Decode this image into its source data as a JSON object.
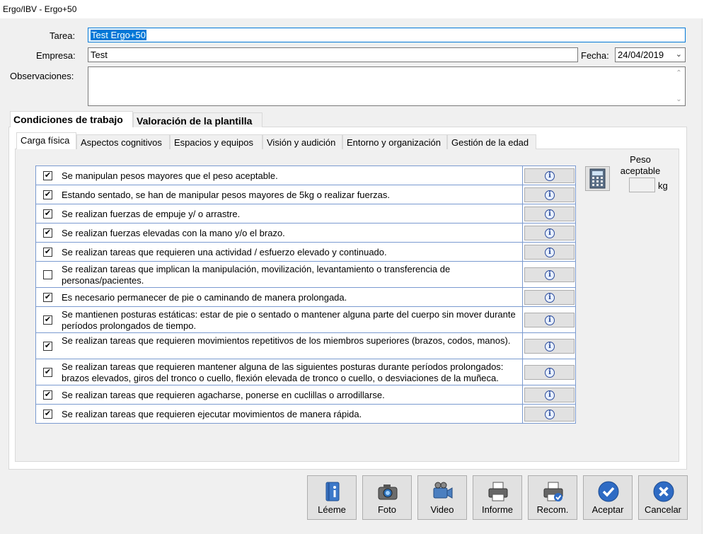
{
  "window": {
    "title": "Ergo/IBV - Ergo+50"
  },
  "form": {
    "tarea_label": "Tarea:",
    "tarea_value": "Test Ergo+50",
    "empresa_label": "Empresa:",
    "empresa_value": "Test",
    "fecha_label": "Fecha:",
    "fecha_value": "24/04/2019",
    "observaciones_label": "Observaciones:",
    "observaciones_value": ""
  },
  "main_tabs": [
    {
      "label": "Condiciones de trabajo",
      "active": true
    },
    {
      "label": "Valoración de la plantilla",
      "active": false
    }
  ],
  "sub_tabs": [
    {
      "label": "Carga física",
      "active": true
    },
    {
      "label": "Aspectos cognitivos",
      "active": false
    },
    {
      "label": "Espacios y equipos",
      "active": false
    },
    {
      "label": "Visión y audición",
      "active": false
    },
    {
      "label": "Entorno y organización",
      "active": false
    },
    {
      "label": "Gestión de la edad",
      "active": false
    }
  ],
  "items": [
    {
      "text": "Se manipulan pesos mayores que el peso aceptable.",
      "checked": true
    },
    {
      "text": "Estando sentado, se han  de manipular pesos mayores de 5kg o realizar fuerzas.",
      "checked": true
    },
    {
      "text": "Se realizan fuerzas de empuje y/ o arrastre.",
      "checked": true
    },
    {
      "text": "Se realizan fuerzas elevadas con la mano y/o el brazo.",
      "checked": true
    },
    {
      "text": "Se realizan tareas que requieren una actividad / esfuerzo elevado y continuado.",
      "checked": true
    },
    {
      "text": "Se realizan tareas que implican la manipulación, movilización, levantamiento o transferencia de personas/pacientes.",
      "checked": false
    },
    {
      "text": "Es necesario permanecer de pie o caminando de manera prolongada.",
      "checked": true
    },
    {
      "text": "Se mantienen posturas estáticas: estar de pie o sentado o mantener alguna parte del cuerpo sin mover durante períodos prolongados de tiempo.",
      "checked": true
    },
    {
      "text": "Se realizan tareas que requieren movimientos repetitivos de los miembros superiores (brazos, codos, manos).",
      "checked": true
    },
    {
      "text": "Se realizan tareas que requieren mantener alguna de las siguientes posturas durante períodos prolongados: brazos elevados, giros del tronco o cuello, flexión elevada de tronco o cuello, o desviaciones de la muñeca.",
      "checked": true
    },
    {
      "text": "Se realizan tareas que requieren agacharse, ponerse en cuclillas o arrodillarse.",
      "checked": true
    },
    {
      "text": "Se realizan tareas que requieren ejecutar movimientos de manera rápida.",
      "checked": true
    }
  ],
  "peso": {
    "label": "Peso aceptable",
    "value": "",
    "unit": "kg"
  },
  "buttons": [
    {
      "label": "Léeme",
      "icon": "book-icon"
    },
    {
      "label": "Foto",
      "icon": "camera-icon"
    },
    {
      "label": "Video",
      "icon": "video-camera-icon"
    },
    {
      "label": "Informe",
      "icon": "printer-icon"
    },
    {
      "label": "Recom.",
      "icon": "printer-check-icon"
    },
    {
      "label": "Aceptar",
      "icon": "check-icon"
    },
    {
      "label": "Cancelar",
      "icon": "close-icon"
    }
  ],
  "colors": {
    "accent": "#0078d7",
    "grid": "#7a9ad0",
    "accept": "#2e6bc4",
    "cancel": "#2e6bc4"
  }
}
